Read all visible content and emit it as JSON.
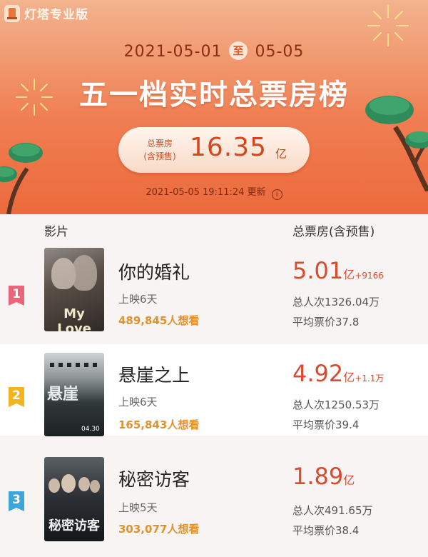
{
  "brand": {
    "name": "灯塔专业版"
  },
  "header": {
    "date_start": "2021-05-01",
    "date_mid": "至",
    "date_end": "05-05",
    "title": "五一档实时总票房榜",
    "total_label_line1": "总票房",
    "total_label_line2": "(含预售)",
    "total_value": "16.35",
    "total_unit": "亿",
    "update_time": "2021-05-05 19:11:24 更新",
    "info_icon": "info-icon"
  },
  "list_header": {
    "film": "影片",
    "box_office": "总票房(含预售)"
  },
  "colors": {
    "accent": "#ec6a3c",
    "rank1": "#e9667a",
    "rank2": "#f2b51d",
    "rank3": "#3aa6dc",
    "value_red": "#d84b2e",
    "want_orange": "#e0922e"
  },
  "movies": [
    {
      "rank": "1",
      "title": "你的婚礼",
      "run_days": "上映6天",
      "want_see": "489,845人想看",
      "box_value": "5.01",
      "box_unit": "亿",
      "box_delta": "+9166",
      "viewers": "总人次1326.04万",
      "avg_price": "平均票价37.8"
    },
    {
      "rank": "2",
      "title": "悬崖之上",
      "run_days": "上映6天",
      "want_see": "165,843人想看",
      "box_value": "4.92",
      "box_unit": "亿",
      "box_delta": "+1.1万",
      "viewers": "总人次1250.53万",
      "avg_price": "平均票价39.4"
    },
    {
      "rank": "3",
      "title": "秘密访客",
      "run_days": "上映5天",
      "want_see": "303,077人想看",
      "box_value": "1.89",
      "box_unit": "亿",
      "box_delta": "",
      "viewers": "总人次491.65万",
      "avg_price": "平均票价38.4"
    }
  ]
}
